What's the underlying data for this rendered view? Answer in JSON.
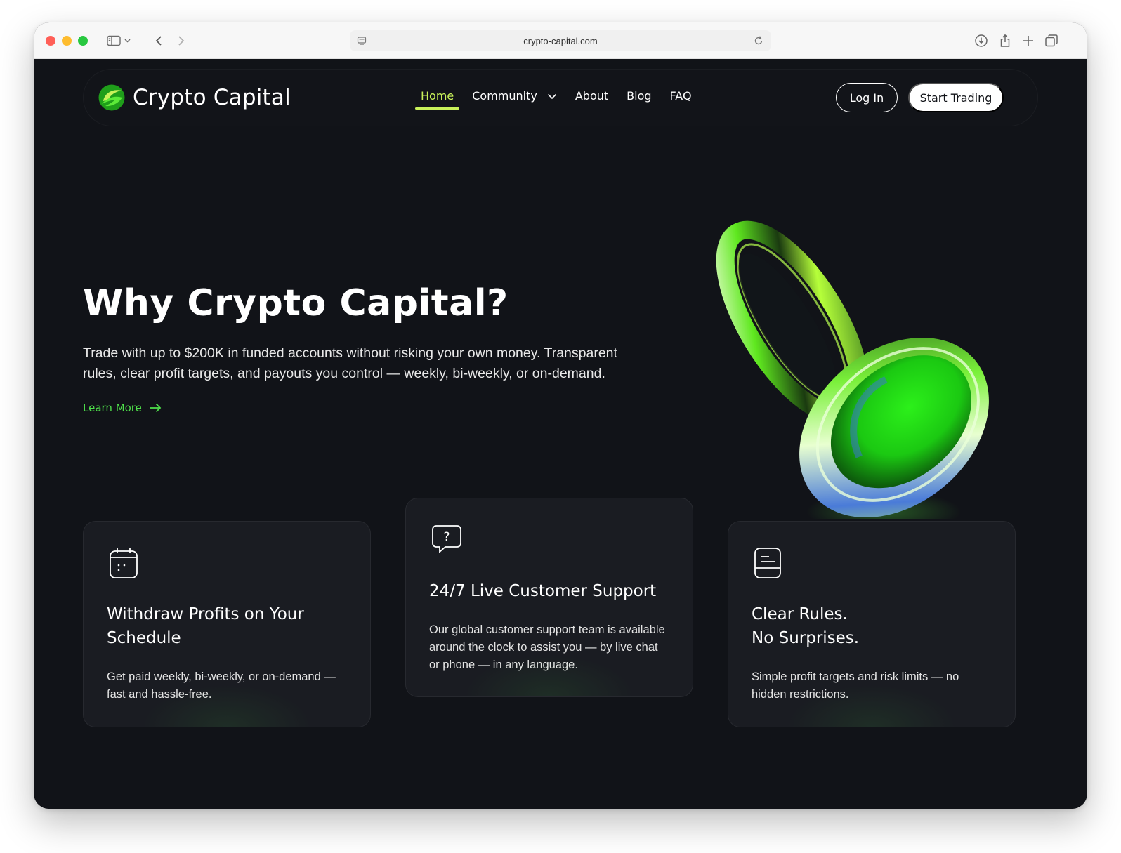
{
  "browser": {
    "url": "crypto-capital.com"
  },
  "brand": {
    "name": "Crypto Capital",
    "accent": "#4ee04a",
    "active_nav_color": "#c9f25a"
  },
  "nav": {
    "items": [
      {
        "label": "Home",
        "active": true
      },
      {
        "label": "Community",
        "dropdown": true
      },
      {
        "label": "About"
      },
      {
        "label": "Blog"
      },
      {
        "label": "FAQ"
      }
    ],
    "login_label": "Log In",
    "start_label": "Start Trading"
  },
  "hero": {
    "title": "Why Crypto Capital?",
    "text": "Trade with up to $200K in funded accounts without risking your own money. Transparent rules, clear profit targets, and payouts you control — weekly, bi-weekly, or on-demand.",
    "link_label": "Learn More"
  },
  "features": [
    {
      "icon": "calendar-icon",
      "title": "Withdraw Profits on Your\nSchedule",
      "text": "Get paid weekly, bi-weekly, or on-demand — fast and hassle-free."
    },
    {
      "icon": "chat-question-icon",
      "title": "24/7 Live Customer Support",
      "text": "Our global customer support team is available around the clock to assist you — by live chat or phone — in any language."
    },
    {
      "icon": "document-icon",
      "title": "Clear Rules.\nNo Surprises.",
      "text": "Simple profit targets and risk limits — no hidden restrictions."
    }
  ]
}
